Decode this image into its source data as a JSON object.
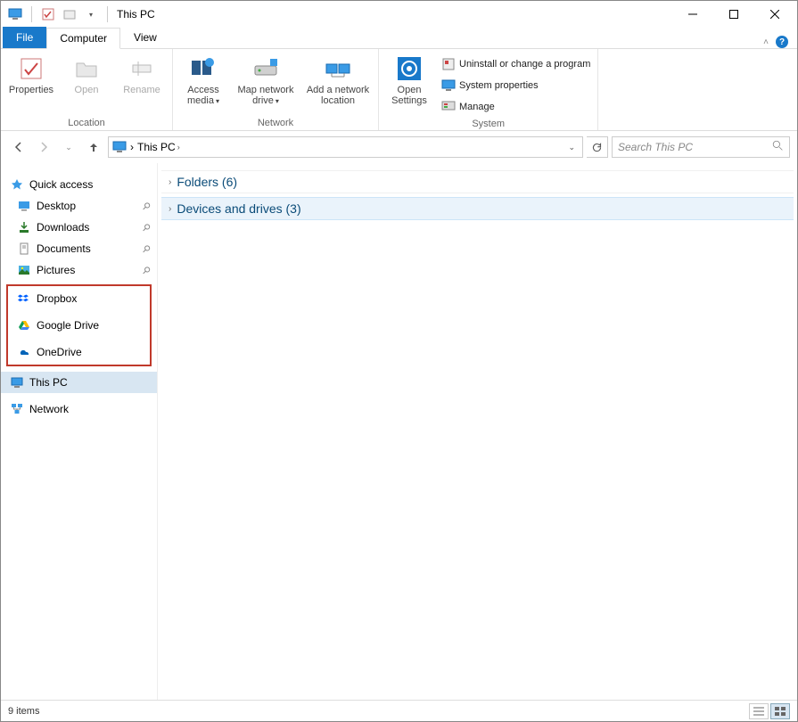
{
  "title": "This PC",
  "tabs": {
    "file": "File",
    "computer": "Computer",
    "view": "View"
  },
  "ribbon": {
    "location": {
      "properties": "Properties",
      "open": "Open",
      "rename": "Rename",
      "label": "Location"
    },
    "network": {
      "access_media": "Access media",
      "map_drive": "Map network drive",
      "add_location": "Add a network location",
      "label": "Network"
    },
    "system": {
      "open_settings": "Open Settings",
      "uninstall": "Uninstall or change a program",
      "sysprops": "System properties",
      "manage": "Manage",
      "label": "System"
    }
  },
  "breadcrumb": {
    "root": "This PC"
  },
  "search": {
    "placeholder": "Search This PC"
  },
  "sidebar": {
    "quick_access": "Quick access",
    "desktop": "Desktop",
    "downloads": "Downloads",
    "documents": "Documents",
    "pictures": "Pictures",
    "dropbox": "Dropbox",
    "gdrive": "Google Drive",
    "onedrive": "OneDrive",
    "this_pc": "This PC",
    "network": "Network"
  },
  "main": {
    "folders": "Folders (6)",
    "devices": "Devices and drives (3)"
  },
  "status": {
    "items": "9 items"
  }
}
